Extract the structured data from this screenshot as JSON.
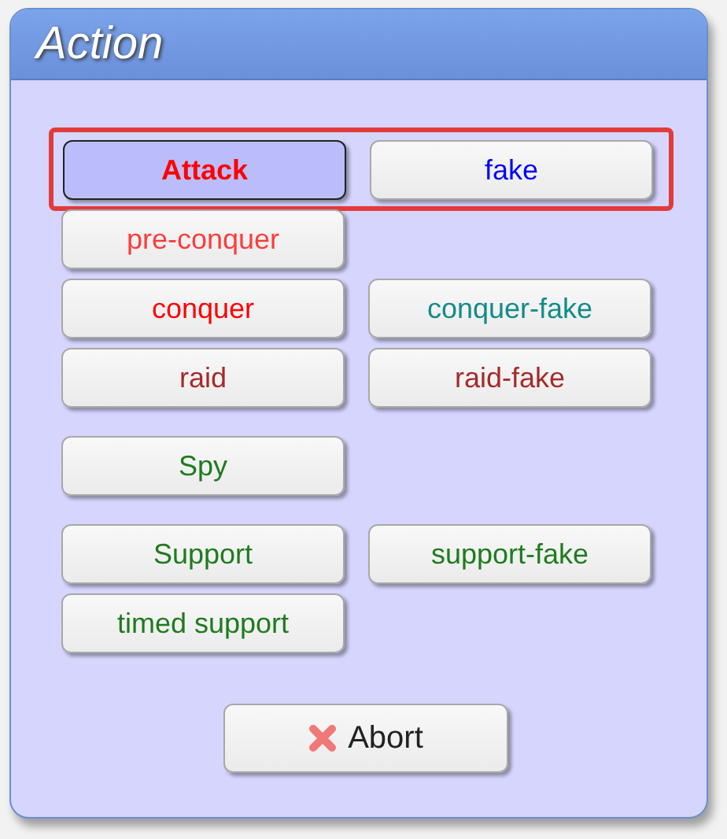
{
  "dialog": {
    "title": "Action",
    "groups": [
      {
        "rows": [
          {
            "highlighted": true,
            "buttons": [
              {
                "label": "Attack",
                "color": "#ff0000",
                "selected": true
              },
              {
                "label": "fake",
                "color": "#0000ff",
                "selected": false
              }
            ]
          },
          {
            "highlighted": false,
            "buttons": [
              {
                "label": "pre-conquer",
                "color": "#ff3b3b",
                "selected": false
              }
            ]
          },
          {
            "highlighted": false,
            "buttons": [
              {
                "label": "conquer",
                "color": "#ff0000",
                "selected": false
              },
              {
                "label": "conquer-fake",
                "color": "#138a8a",
                "selected": false
              }
            ]
          },
          {
            "highlighted": false,
            "buttons": [
              {
                "label": "raid",
                "color": "#a52a2a",
                "selected": false
              },
              {
                "label": "raid-fake",
                "color": "#a52a2a",
                "selected": false
              }
            ]
          }
        ]
      },
      {
        "rows": [
          {
            "highlighted": false,
            "buttons": [
              {
                "label": "Spy",
                "color": "#1e7b1e",
                "selected": false
              }
            ]
          }
        ]
      },
      {
        "rows": [
          {
            "highlighted": false,
            "buttons": [
              {
                "label": "Support",
                "color": "#1e7b1e",
                "selected": false
              },
              {
                "label": "support-fake",
                "color": "#1e7b1e",
                "selected": false
              }
            ]
          },
          {
            "highlighted": false,
            "buttons": [
              {
                "label": "timed support",
                "color": "#1e7b1e",
                "selected": false
              }
            ]
          }
        ]
      }
    ],
    "abort": {
      "label": "Abort"
    }
  }
}
